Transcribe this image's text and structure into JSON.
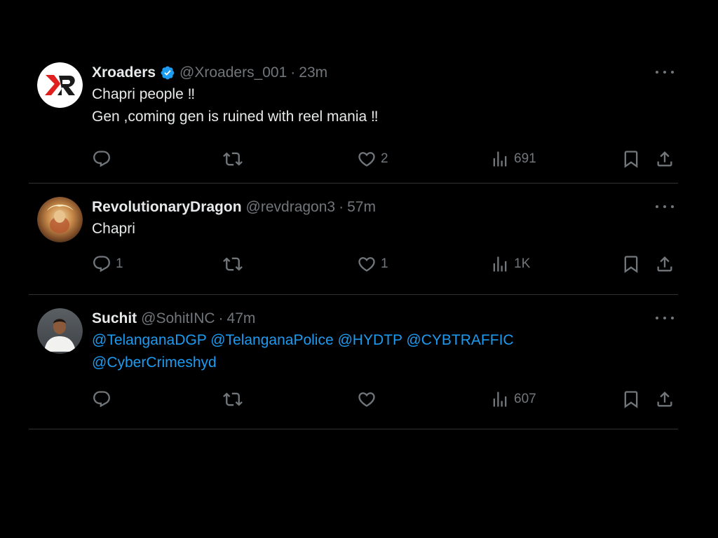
{
  "tweets": [
    {
      "display_name": "Xroaders",
      "verified": true,
      "handle": "@Xroaders_001",
      "time": "23m",
      "lines": [
        "Chapri people ‼",
        "Gen ,coming gen is ruined with reel mania ‼"
      ],
      "stats": {
        "replies": "",
        "retweets": "",
        "likes": "2",
        "views": "691"
      },
      "avatar": "xr-logo"
    },
    {
      "display_name": "RevolutionaryDragon",
      "verified": false,
      "handle": "@revdragon3",
      "time": "57m",
      "lines": [
        "Chapri"
      ],
      "stats": {
        "replies": "1",
        "retweets": "",
        "likes": "1",
        "views": "1K"
      },
      "avatar": "dragon-portrait"
    },
    {
      "display_name": "Suchit",
      "verified": false,
      "handle": "@SohitINC",
      "time": "47m",
      "mentions_line1": "@TelanganaDGP @TelanganaPolice @HYDTP @CYBTRAFFIC",
      "mentions_line2": "@CyberCrimeshyd",
      "stats": {
        "replies": "",
        "retweets": "",
        "likes": "",
        "views": "607"
      },
      "avatar": "person-photo"
    }
  ],
  "separator_dot": "·",
  "colors": {
    "background": "#000000",
    "text": "#e7e9ea",
    "muted": "#71767b",
    "link": "#1d9bf0",
    "divider": "#2f3336",
    "verified": "#1d9bf0"
  },
  "icons": [
    "reply-icon",
    "retweet-icon",
    "like-icon",
    "views-icon",
    "bookmark-icon",
    "share-icon",
    "more-icon",
    "verified-badge-icon"
  ]
}
